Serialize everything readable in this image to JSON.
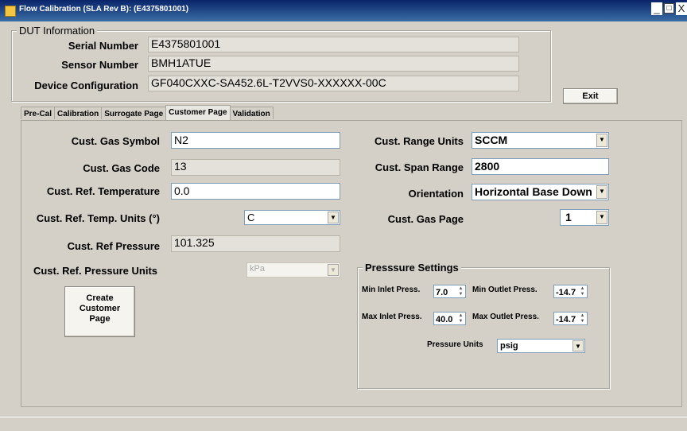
{
  "window": {
    "title": "Flow Calibration (SLA Rev B): (E4375801001)",
    "minimize": "_",
    "maximize": "□",
    "close": "X"
  },
  "dut": {
    "legend": "DUT Information",
    "serial_label": "Serial Number",
    "serial_value": "E4375801001",
    "sensor_label": "Sensor Number",
    "sensor_value": "BMH1ATUE",
    "config_label": "Device Configuration",
    "config_value": "GF040CXXC-SA452.6L-T2VVS0-XXXXXX-00C"
  },
  "exit_label": "Exit",
  "tabs": [
    {
      "label": "Pre-Cal",
      "active": false
    },
    {
      "label": "Calibration",
      "active": false
    },
    {
      "label": "Surrogate Page",
      "active": false
    },
    {
      "label": "Customer Page",
      "active": true
    },
    {
      "label": "Validation",
      "active": false
    }
  ],
  "customer": {
    "gas_symbol_label": "Cust. Gas Symbol",
    "gas_symbol_value": "N2",
    "gas_code_label": "Cust. Gas Code",
    "gas_code_value": "13",
    "ref_temp_label": "Cust. Ref. Temperature",
    "ref_temp_value": "0.0",
    "ref_temp_units_label": "Cust. Ref. Temp. Units (°)",
    "ref_temp_units_value": "C",
    "ref_pressure_label": "Cust. Ref Pressure",
    "ref_pressure_value": "101.325",
    "ref_pressure_units_label": "Cust. Ref. Pressure Units",
    "ref_pressure_units_value": "kPa",
    "create_button": "Create\nCustomer\nPage",
    "range_units_label": "Cust. Range Units",
    "range_units_value": "SCCM",
    "span_range_label": "Cust. Span Range",
    "span_range_value": "2800",
    "orientation_label": "Orientation",
    "orientation_value": "Horizontal Base Down",
    "gas_page_label": "Cust. Gas Page",
    "gas_page_value": "1"
  },
  "pressure": {
    "legend": "Presssure Settings",
    "min_inlet_label": "Min Inlet Press.",
    "min_inlet_value": "7.0",
    "min_outlet_label": "Min Outlet Press.",
    "min_outlet_value": "-14.7",
    "max_inlet_label": "Max Inlet Press.",
    "max_inlet_value": "40.0",
    "max_outlet_label": "Max Outlet Press.",
    "max_outlet_value": "-14.7",
    "units_label": "Pressure Units",
    "units_value": "psig"
  }
}
